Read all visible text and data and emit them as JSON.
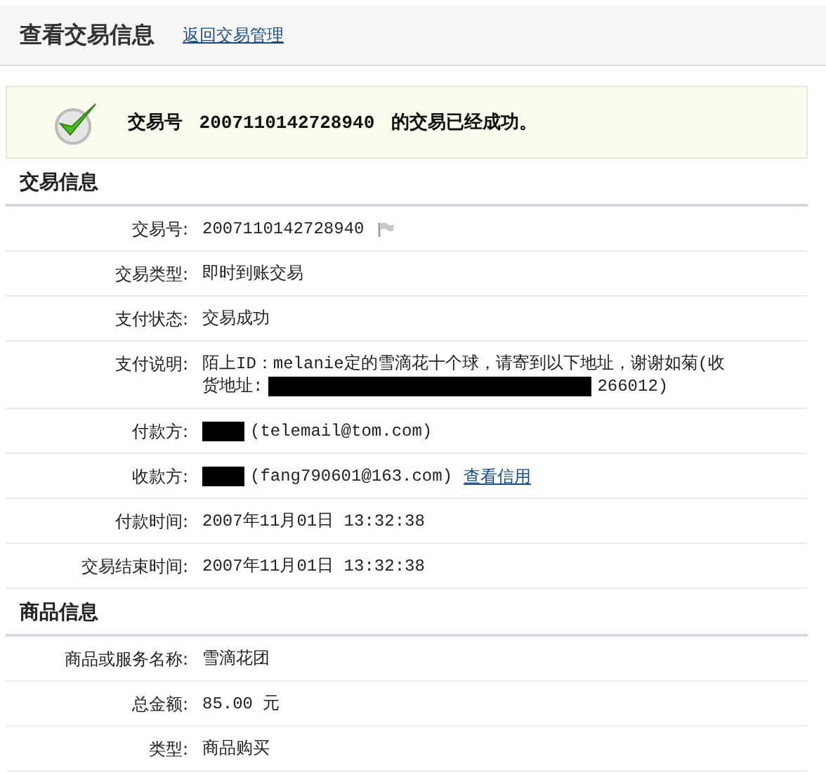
{
  "header": {
    "title": "查看交易信息",
    "link": "返回交易管理"
  },
  "notice": {
    "parts": [
      "交易号",
      "2007110142728940",
      "的交易已经成功。"
    ]
  },
  "sections": [
    {
      "title": "交易信息",
      "rows": [
        {
          "label": "交易号:",
          "lines": [
            [
              {
                "kind": "text",
                "text": "2007110142728940"
              },
              {
                "kind": "flag"
              }
            ]
          ]
        },
        {
          "label": "交易类型:",
          "lines": [
            [
              {
                "kind": "text",
                "text": "即时到账交易"
              }
            ]
          ]
        },
        {
          "label": "支付状态:",
          "lines": [
            [
              {
                "kind": "text",
                "text": "交易成功"
              }
            ]
          ]
        },
        {
          "label": "支付说明:",
          "lines": [
            [
              {
                "kind": "text",
                "text": "陌上ID：melanie定的雪滴花十个球，请寄到以下地址，谢谢如菊(收"
              }
            ],
            [
              {
                "kind": "text",
                "text": "货地址:"
              },
              {
                "kind": "redacted_long"
              },
              {
                "kind": "text",
                "text": "266012)"
              }
            ]
          ]
        },
        {
          "label": "付款方:",
          "lines": [
            [
              {
                "kind": "redacted"
              },
              {
                "kind": "text",
                "text": "(telemail@tom.com)"
              }
            ]
          ]
        },
        {
          "label": "收款方:",
          "lines": [
            [
              {
                "kind": "redacted"
              },
              {
                "kind": "text",
                "text": "(fang790601@163.com)"
              },
              {
                "kind": "link",
                "text": "查看信用"
              }
            ]
          ]
        },
        {
          "label": "付款时间:",
          "lines": [
            [
              {
                "kind": "text",
                "text": "2007年11月01日 13:32:38"
              }
            ]
          ]
        },
        {
          "label": "交易结束时间:",
          "lines": [
            [
              {
                "kind": "text",
                "text": "2007年11月01日 13:32:38"
              }
            ]
          ]
        }
      ]
    },
    {
      "title": "商品信息",
      "rows": [
        {
          "label": "商品或服务名称:",
          "lines": [
            [
              {
                "kind": "text",
                "text": "雪滴花团"
              }
            ]
          ]
        },
        {
          "label": "总金额:",
          "lines": [
            [
              {
                "kind": "text",
                "text": "85.00 元"
              }
            ]
          ]
        },
        {
          "label": "类型:",
          "lines": [
            [
              {
                "kind": "text",
                "text": "商品购买"
              }
            ]
          ]
        }
      ]
    }
  ]
}
